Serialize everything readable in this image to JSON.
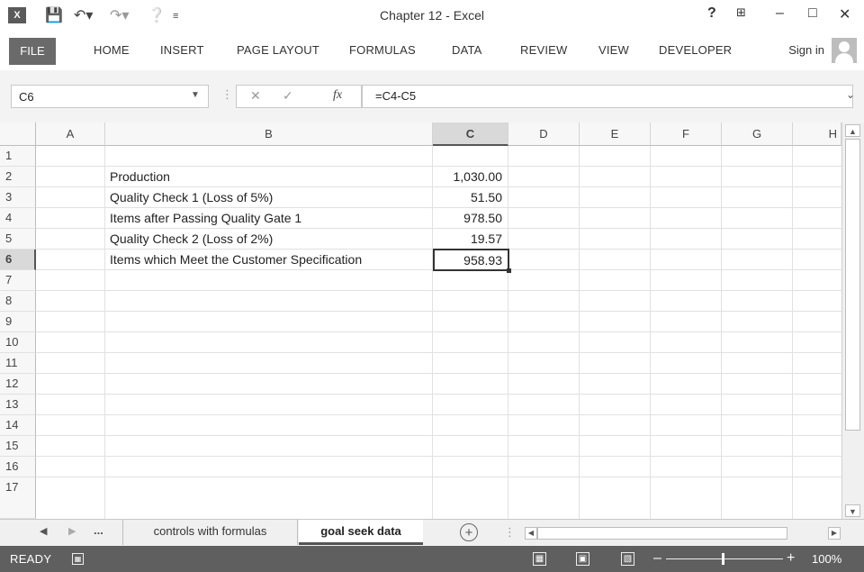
{
  "app": {
    "title": "Chapter 12 - Excel",
    "logo": "X"
  },
  "quick_access": [
    "save-icon",
    "undo-icon",
    "redo-icon",
    "help-circle-icon",
    "customize-icon"
  ],
  "window_controls": {
    "help": "?",
    "ribbon_display": "⊞",
    "minimize": "–",
    "restore": "□",
    "close": "✕"
  },
  "ribbon": {
    "file": "FILE",
    "tabs": [
      "HOME",
      "INSERT",
      "PAGE LAYOUT",
      "FORMULAS",
      "DATA",
      "REVIEW",
      "VIEW",
      "DEVELOPER"
    ],
    "sign_in": "Sign in"
  },
  "formula_bar": {
    "name_box": "C6",
    "formula": "=C4-C5",
    "fx": "fx"
  },
  "columns": [
    "A",
    "B",
    "C",
    "D",
    "E",
    "F",
    "G",
    "H"
  ],
  "selected_column": "C",
  "rows": [
    "1",
    "2",
    "3",
    "4",
    "5",
    "6",
    "7",
    "8",
    "9",
    "10",
    "11",
    "12",
    "13",
    "14",
    "15",
    "16",
    "17"
  ],
  "selected_row": "6",
  "cells": {
    "B2": "Production",
    "C2": "1,030.00",
    "B3": "Quality Check 1 (Loss of 5%)",
    "C3": "51.50",
    "B4": "Items after Passing Quality Gate 1",
    "C4": "978.50",
    "B5": "Quality Check 2 (Loss of 2%)",
    "C5": "19.57",
    "B6": "Items which Meet the Customer Specification",
    "C6": "958.93"
  },
  "sheets": {
    "ellipsis": "...",
    "tabs": [
      "controls with formulas",
      "goal seek data"
    ],
    "active": "goal seek data"
  },
  "status": {
    "mode": "READY",
    "zoom": "100%"
  }
}
